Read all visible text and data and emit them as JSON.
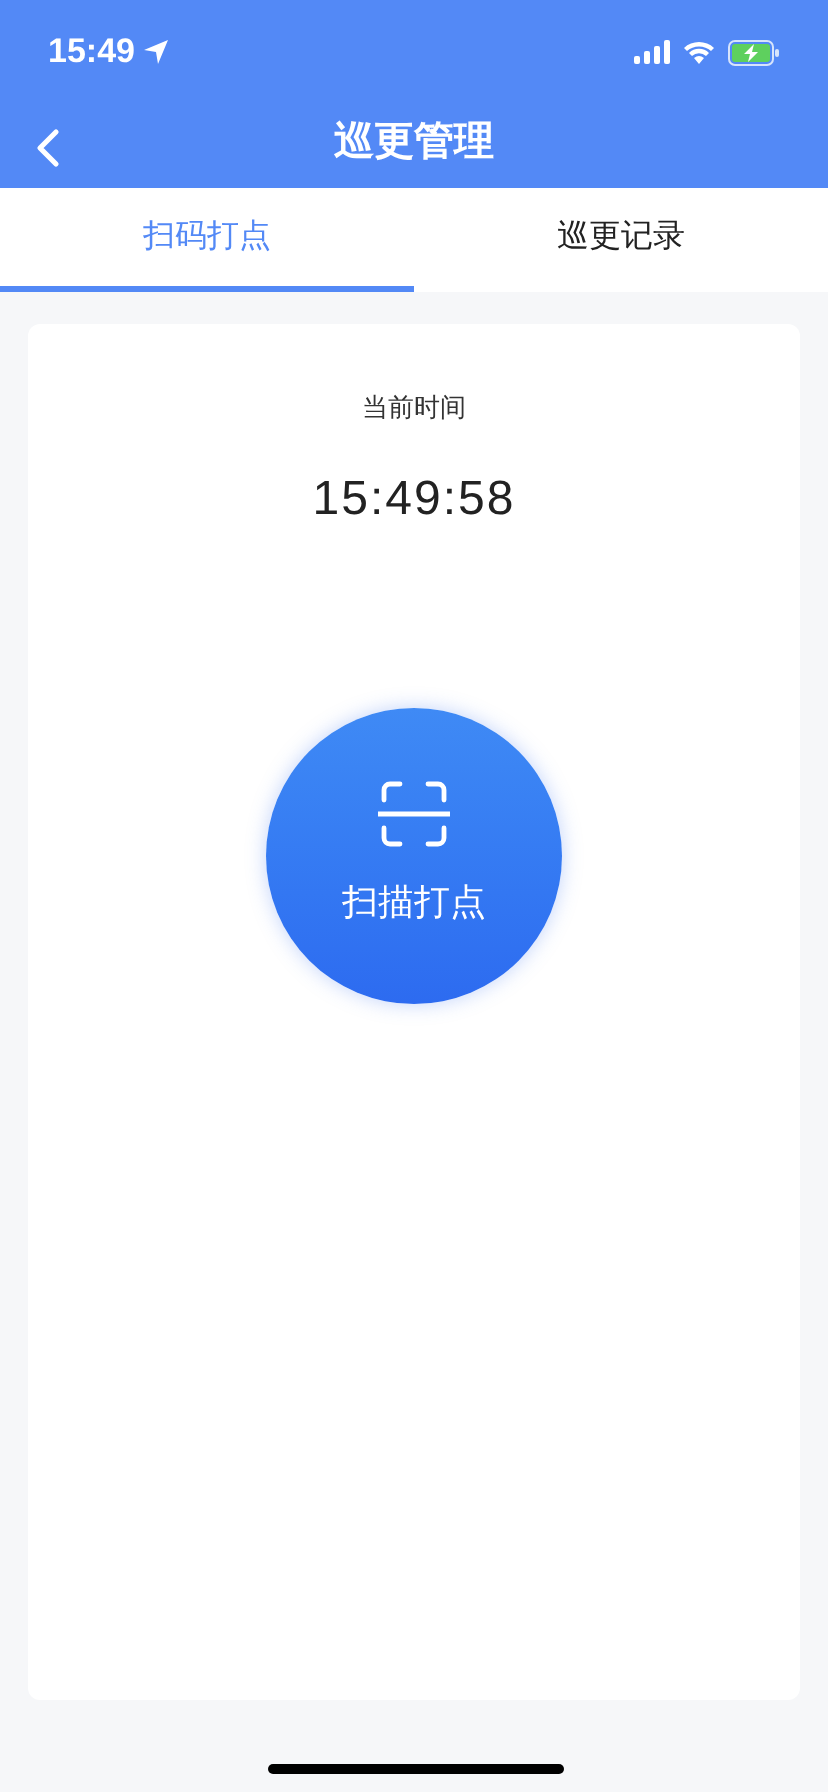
{
  "status_bar": {
    "time": "15:49"
  },
  "header": {
    "title": "巡更管理"
  },
  "tabs": [
    {
      "label": "扫码打点",
      "selected": true
    },
    {
      "label": "巡更记录",
      "selected": false
    }
  ],
  "card": {
    "label": "当前时间",
    "time": "15:49:58",
    "scan_button": "扫描打点"
  }
}
